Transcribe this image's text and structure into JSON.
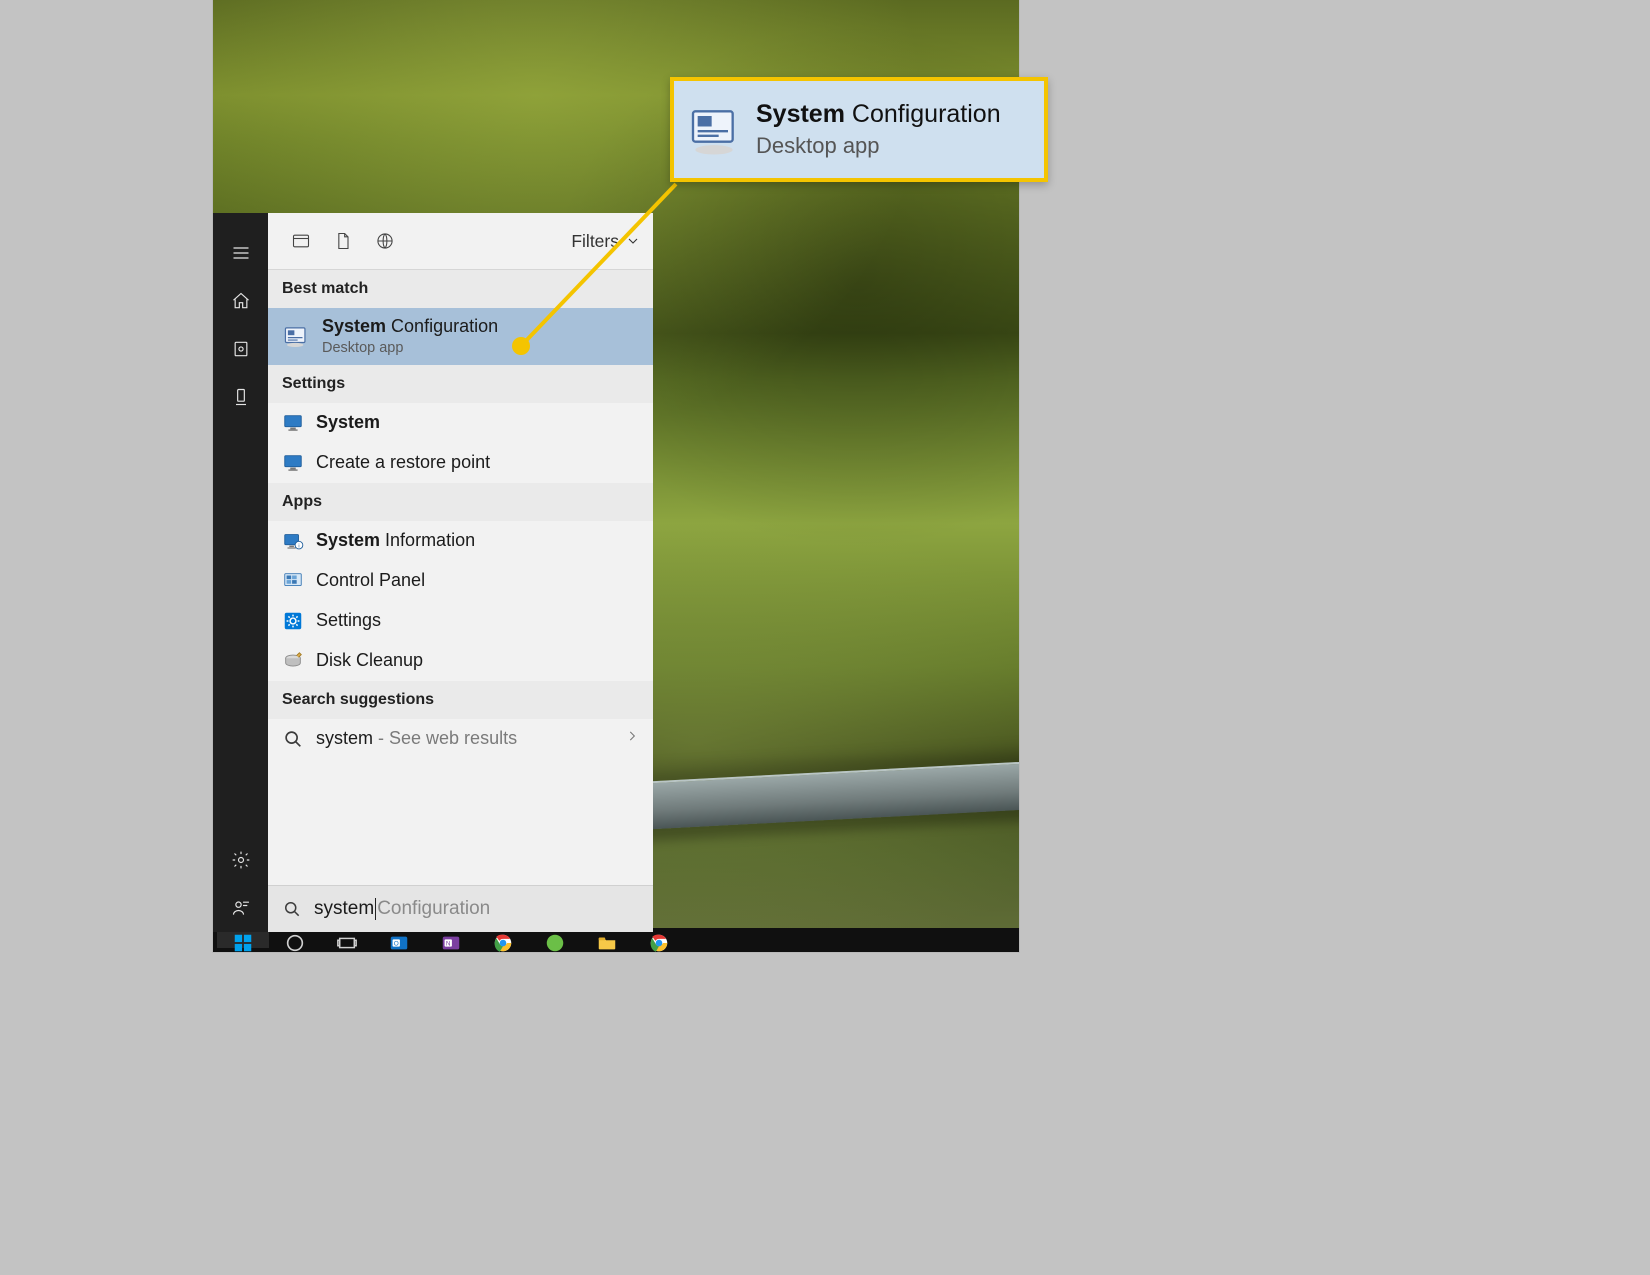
{
  "callout": {
    "title_bold": "System",
    "title_rest": " Configuration",
    "subtitle": "Desktop app"
  },
  "top_tabs": {
    "filters_label": "Filters"
  },
  "sections": {
    "best_match": "Best match",
    "settings": "Settings",
    "apps": "Apps",
    "search_suggestions": "Search suggestions"
  },
  "best_match_item": {
    "title_bold": "System",
    "title_rest": " Configuration",
    "subtitle": "Desktop app"
  },
  "settings_items": [
    {
      "title_bold": "System",
      "title_rest": ""
    },
    {
      "title_bold": "",
      "title_rest": "Create a restore point"
    }
  ],
  "apps_items": [
    {
      "title_bold": "System",
      "title_rest": " Information"
    },
    {
      "title_bold": "",
      "title_rest": "Control Panel"
    },
    {
      "title_bold": "",
      "title_rest": "Settings"
    },
    {
      "title_bold": "",
      "title_rest": "Disk Cleanup"
    }
  ],
  "web_suggestion": {
    "query": "system",
    "suffix": " - See web results"
  },
  "search": {
    "typed": "system",
    "ghost": "Configuration"
  }
}
